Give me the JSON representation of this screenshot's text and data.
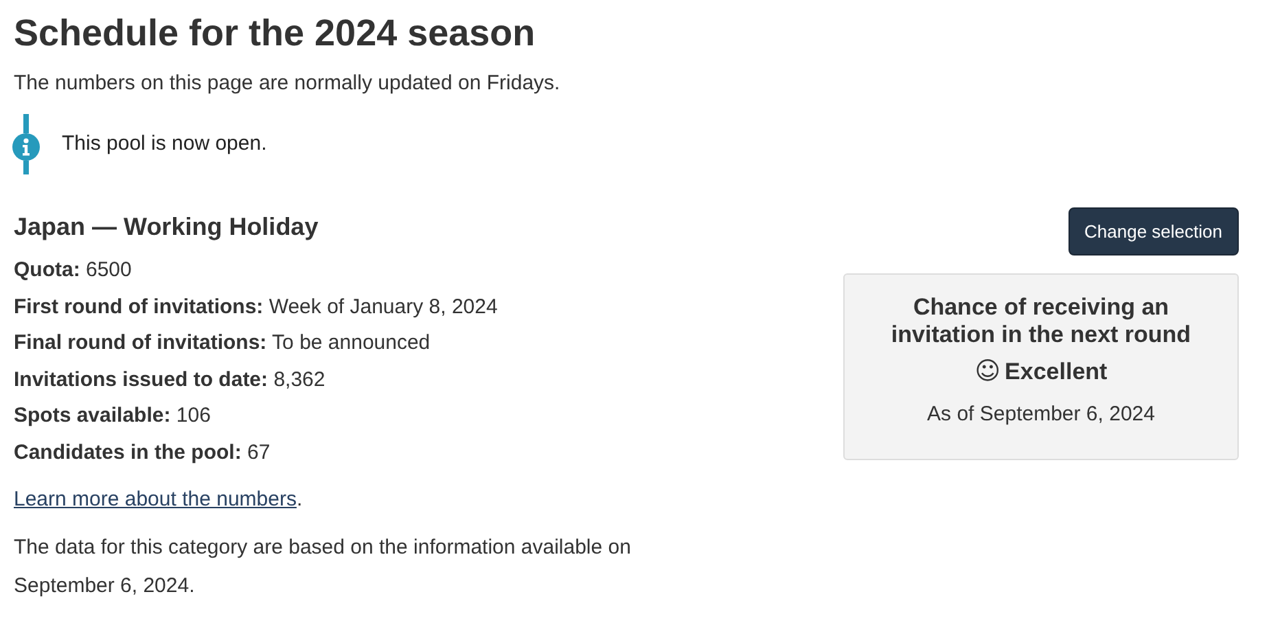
{
  "page_title": "Schedule for the 2024 season",
  "intro": "The numbers on this page are normally updated on Fridays.",
  "notice": {
    "kind": "info",
    "text": "This pool is now open."
  },
  "category": {
    "title": "Japan — Working Holiday",
    "button": "Change selection"
  },
  "facts": [
    {
      "label": "Quota:",
      "value": "6500"
    },
    {
      "label": "First round of invitations:",
      "value": "Week of January 8, 2024"
    },
    {
      "label": "Final round of invitations:",
      "value": "To be announced"
    },
    {
      "label": "Invitations issued to date:",
      "value": "8,362"
    },
    {
      "label": "Spots available:",
      "value": "106"
    },
    {
      "label": "Candidates in the pool:",
      "value": "67"
    }
  ],
  "learn_more": {
    "link": "Learn more about the numbers",
    "suffix": "."
  },
  "data_note": "The data for this category are based on the information available on September 6, 2024.",
  "chance_card": {
    "heading": "Chance of receiving an invitation in the next round",
    "symbol": "☺",
    "rating": "Excellent",
    "as_of": "As of September 6, 2024"
  }
}
